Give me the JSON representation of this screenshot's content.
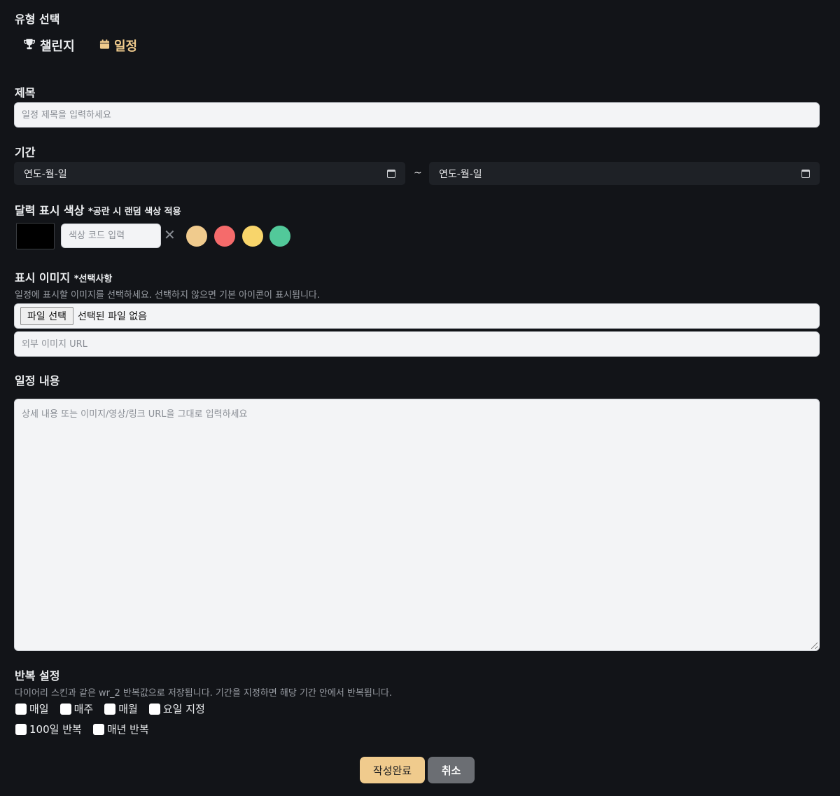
{
  "type_select": {
    "label": "유형 선택",
    "options": [
      {
        "label": "챌린지",
        "icon": "trophy-icon"
      },
      {
        "label": "일정",
        "icon": "calendar-icon"
      }
    ],
    "selected": "일정"
  },
  "title": {
    "label": "제목",
    "placeholder": "일정 제목을 입력하세요"
  },
  "period": {
    "label": "기간",
    "start_value": "연도-월-일",
    "separator": "~",
    "end_value": "연도-월-일"
  },
  "color": {
    "label": "달력 표시 색상",
    "note": "*공란 시 랜덤 색상 적용",
    "current_color": "#000000",
    "code_placeholder": "색상 코드 입력",
    "clear_symbol": "✕",
    "swatches": [
      "#f0cb8d",
      "#f56b6b",
      "#f8d56b",
      "#52c99a"
    ]
  },
  "image": {
    "label": "표시 이미지",
    "note": "*선택사항",
    "help": "일정에 표시할 이미지를 선택하세요. 선택하지 않으면 기본 아이콘이 표시됩니다.",
    "file_button": "파일 선택",
    "file_status": "선택된 파일 없음",
    "url_placeholder": "외부 이미지 URL"
  },
  "content": {
    "label": "일정 내용",
    "placeholder": "상세 내용 또는 이미지/영상/링크 URL을 그대로 입력하세요"
  },
  "repeat": {
    "label": "반복 설정",
    "help": "다이어리 스킨과 같은 wr_2 반복값으로 저장됩니다. 기간을 지정하면 해당 기간 안에서 반복됩니다.",
    "options_row1": [
      "매일",
      "매주",
      "매월",
      "요일 지정"
    ],
    "options_row2": [
      "100일 반복",
      "매년 반복"
    ]
  },
  "actions": {
    "submit": "작성완료",
    "cancel": "취소"
  },
  "colors": {
    "background": "#121418",
    "accent": "#f0cb8d",
    "cancel_bg": "#6b6e73"
  }
}
